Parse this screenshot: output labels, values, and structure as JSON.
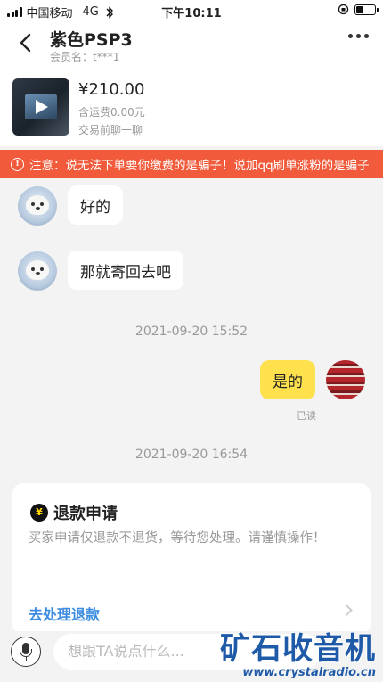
{
  "status_bar": {
    "carrier": "中国移动",
    "network": "4G",
    "time": "下午10:11"
  },
  "header": {
    "title": "紫色PSP3",
    "member_label": "会员名：t***1"
  },
  "product": {
    "price": "¥210.00",
    "shipping": "含运费0.00元",
    "contact": "交易前聊一聊"
  },
  "warning": {
    "text": "注意：说无法下单要你缴费的是骗子！说加qq刷单涨粉的是骗子"
  },
  "messages": [
    {
      "from": "other",
      "text": "好的"
    },
    {
      "from": "other",
      "text": "那就寄回去吧"
    },
    {
      "type": "timestamp",
      "text": "2021-09-20 15:52"
    },
    {
      "from": "me",
      "text": "是的",
      "status": "已读"
    },
    {
      "type": "timestamp",
      "text": "2021-09-20 16:54"
    }
  ],
  "refund_card": {
    "icon": "¥",
    "title": "退款申请",
    "description": "买家申请仅退款不退货，等待您处理。请谨慎操作！",
    "action": "去处理退款"
  },
  "input_bar": {
    "placeholder": "想跟TA说点什么..."
  },
  "watermark": {
    "title": "矿石收音机",
    "url": "www.crystalradio.cn"
  },
  "colors": {
    "warning_bg": "#f15a3a",
    "my_bubble": "#ffe14d",
    "link": "#3b8ce0"
  }
}
